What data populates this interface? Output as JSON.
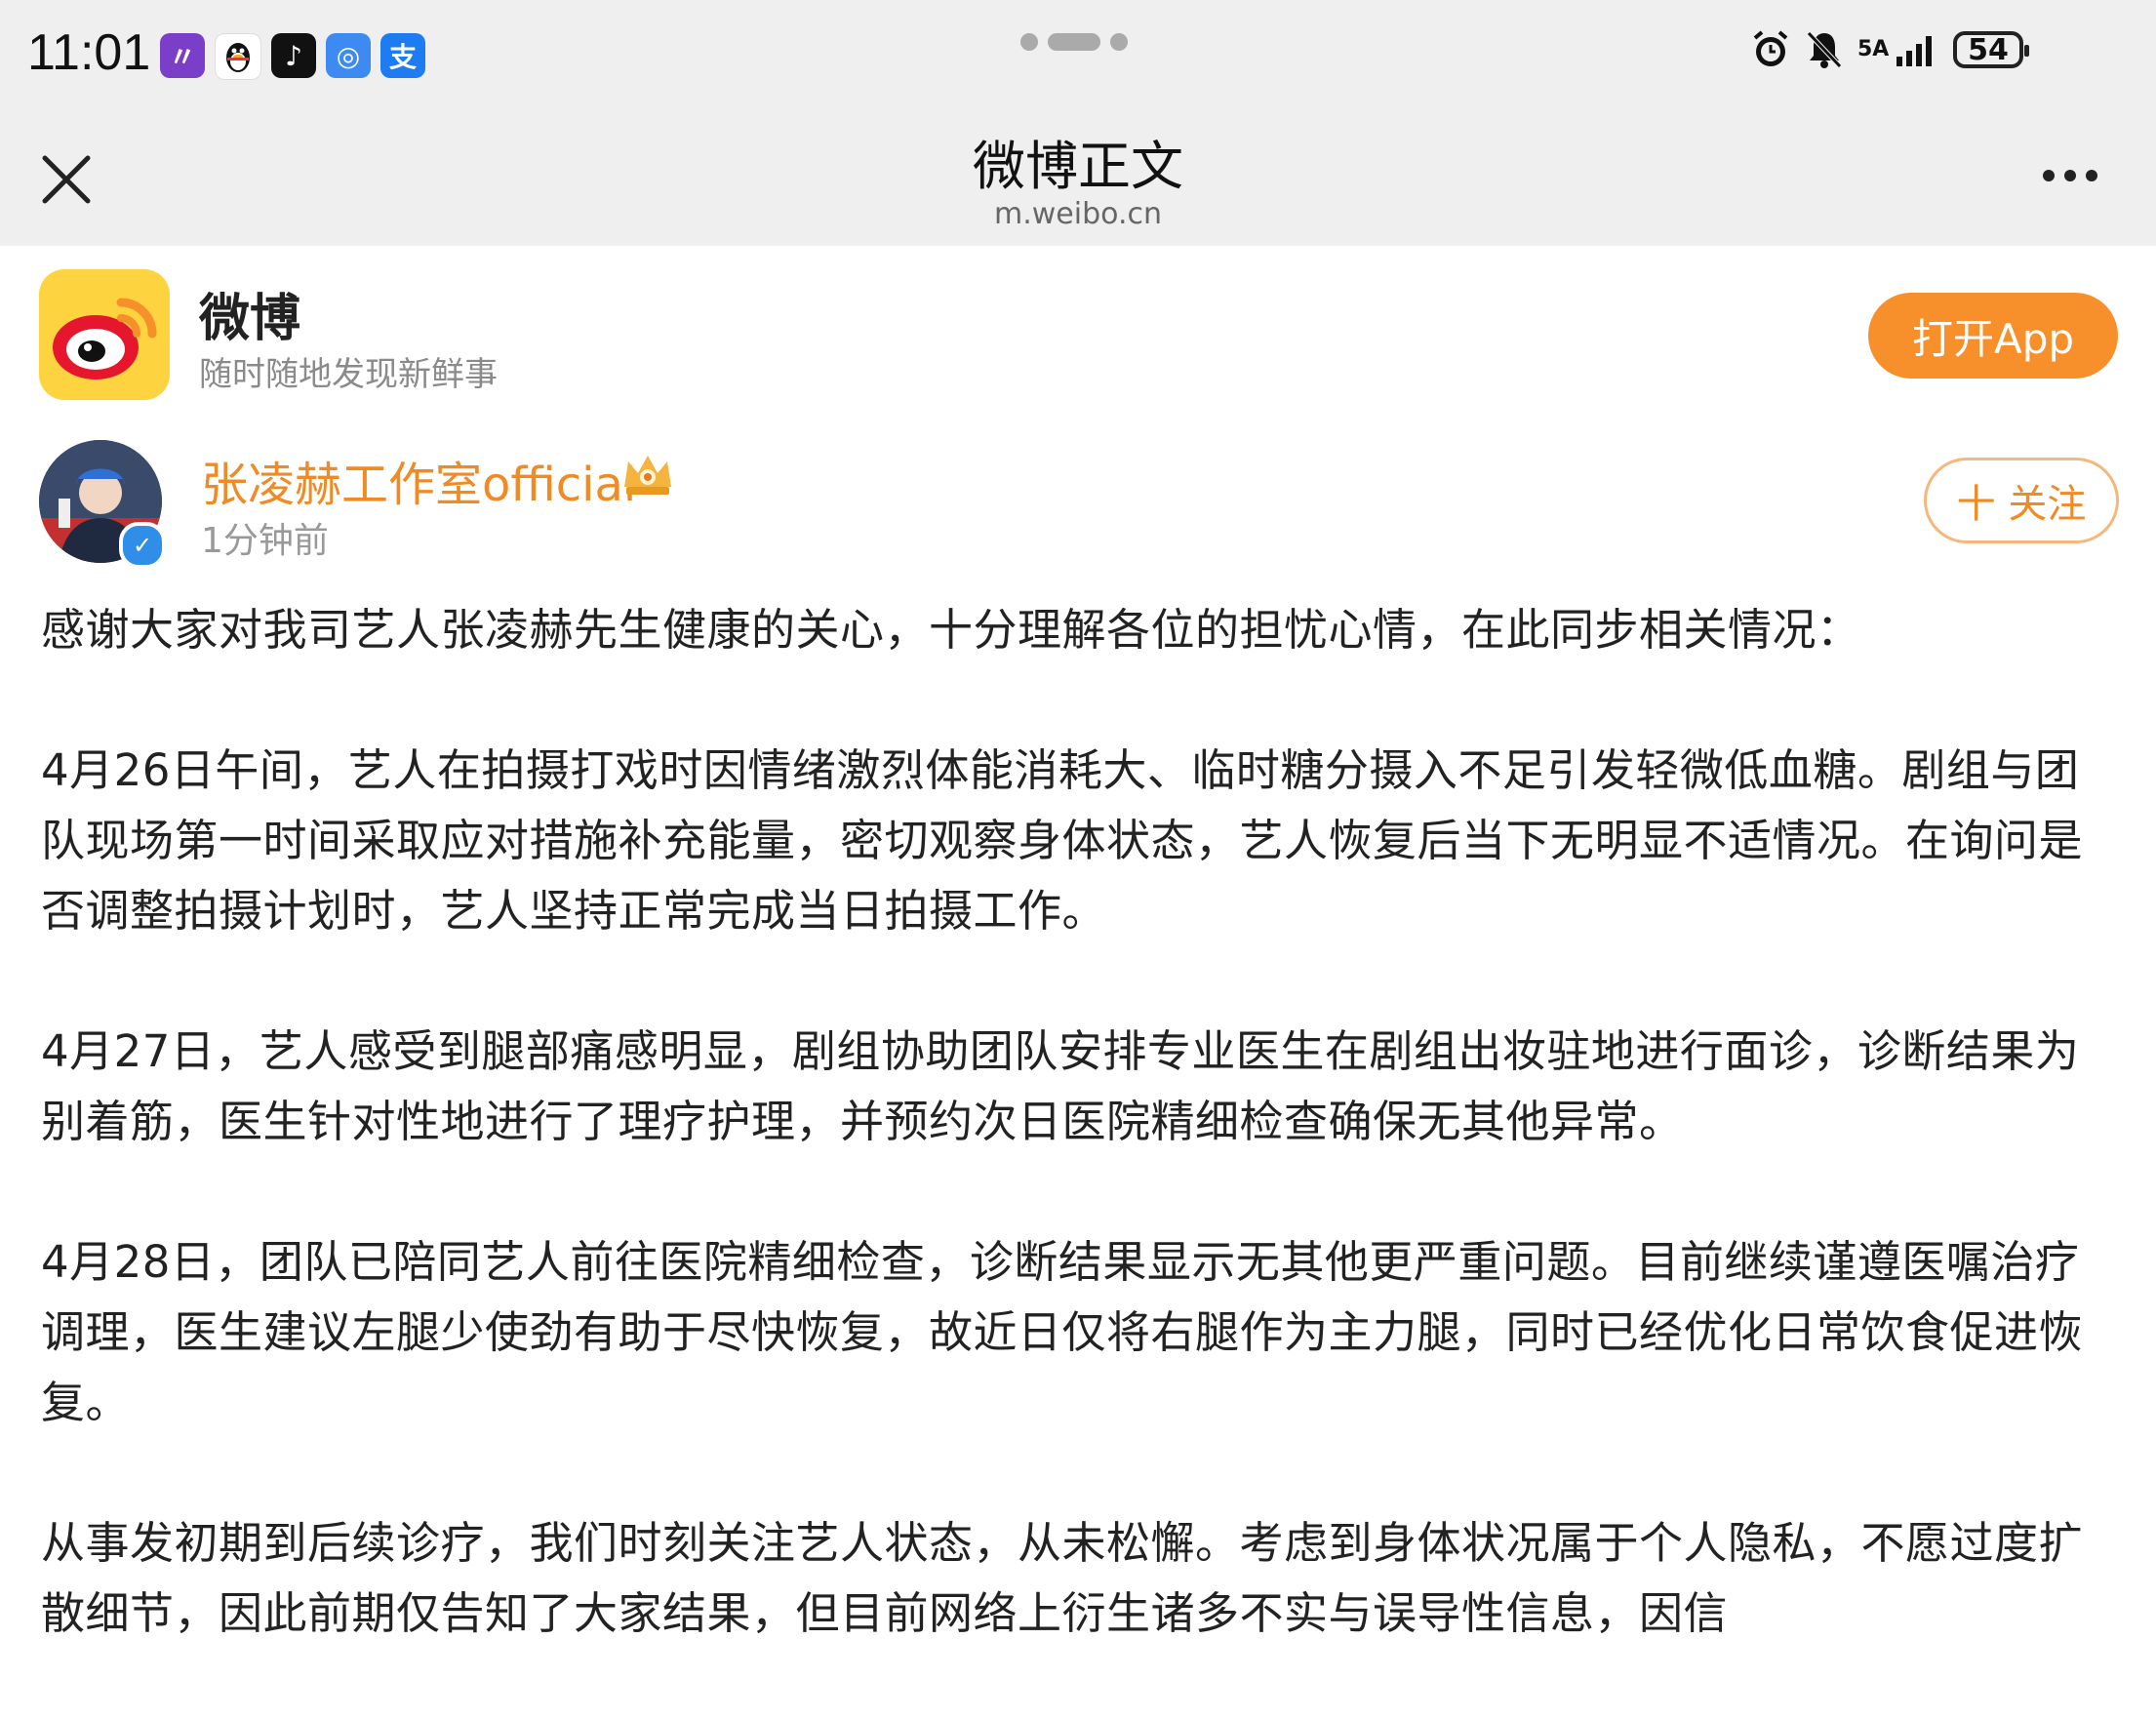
{
  "status_bar": {
    "time": "11:01",
    "app_icons": [
      {
        "name": "notes-app-icon",
        "glyph": "〃",
        "color": "#7a3ec9"
      },
      {
        "name": "qq-app-icon",
        "glyph": "🐧",
        "color": "#ffffff"
      },
      {
        "name": "douyin-app-icon",
        "glyph": "♪",
        "color": "#111111"
      },
      {
        "name": "hotspot-app-icon",
        "glyph": "◎",
        "color": "#3d8bf2"
      },
      {
        "name": "alipay-app-icon",
        "glyph": "支",
        "color": "#1d7cf2"
      }
    ],
    "network_label": "5A",
    "battery": "54"
  },
  "nav": {
    "title": "微博正文",
    "subtitle": "m.weibo.cn"
  },
  "promo": {
    "app_name": "微博",
    "slogan": "随时随地发现新鲜事",
    "open_label": "打开App",
    "accent_color": "#f7902b"
  },
  "author": {
    "name": "张凌赫工作室official",
    "time": "1分钟前",
    "follow_label": "十 关注",
    "name_color": "#f08a24"
  },
  "post": {
    "paragraphs": [
      "感谢大家对我司艺人张凌赫先生健康的关心，十分理解各位的担忧心情，在此同步相关情况：",
      "4月26日午间，艺人在拍摄打戏时因情绪激烈体能消耗大、临时糖分摄入不足引发轻微低血糖。剧组与团队现场第一时间采取应对措施补充能量，密切观察身体状态，艺人恢复后当下无明显不适情况。在询问是否调整拍摄计划时，艺人坚持正常完成当日拍摄工作。",
      "4月27日，艺人感受到腿部痛感明显，剧组协助团队安排专业医生在剧组出妆驻地进行面诊，诊断结果为别着筋，医生针对性地进行了理疗护理，并预约次日医院精细检查确保无其他异常。",
      "4月28日，团队已陪同艺人前往医院精细检查，诊断结果显示无其他更严重问题。目前继续谨遵医嘱治疗调理，医生建议左腿少使劲有助于尽快恢复，故近日仅将右腿作为主力腿，同时已经优化日常饮食促进恢复。",
      "从事发初期到后续诊疗，我们时刻关注艺人状态，从未松懈。考虑到身体状况属于个人隐私，不愿过度扩散细节，因此前期仅告知了大家结果，但目前网络上衍生诸多不实与误导性信息，因信"
    ]
  }
}
